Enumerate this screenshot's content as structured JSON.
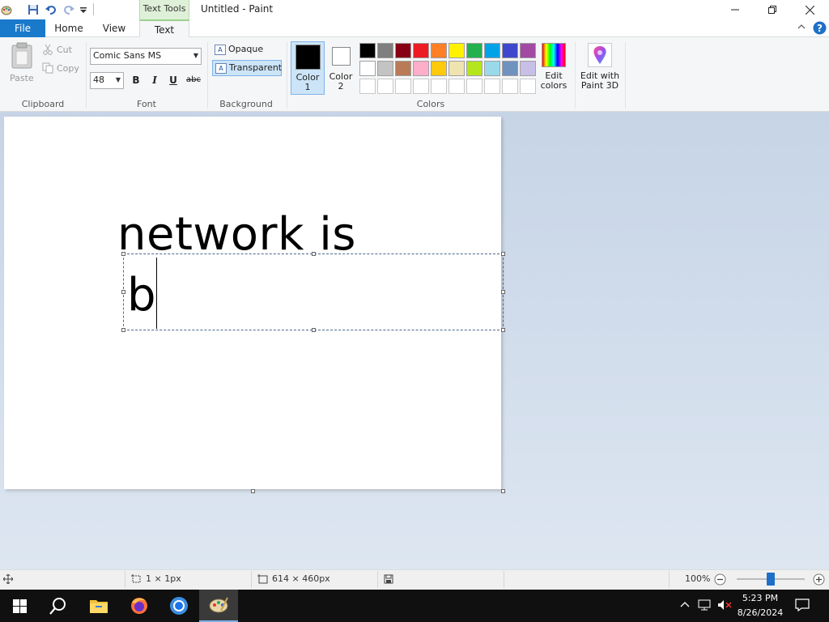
{
  "window": {
    "title": "Untitled - Paint",
    "context_tab_label": "Text Tools"
  },
  "tabs": [
    {
      "label": "File"
    },
    {
      "label": "Home"
    },
    {
      "label": "View"
    },
    {
      "label": "Text"
    }
  ],
  "clipboard": {
    "paste_label": "Paste",
    "cut_label": "Cut",
    "copy_label": "Copy",
    "group_label": "Clipboard"
  },
  "font": {
    "family": "Comic Sans MS",
    "size": "48",
    "bold_label": "B",
    "italic_label": "I",
    "underline_label": "U",
    "strike_label": "abc",
    "group_label": "Font"
  },
  "background": {
    "opaque_label": "Opaque",
    "transparent_label": "Transparent",
    "group_label": "Background",
    "selected": "Transparent"
  },
  "colors": {
    "color1_label": "Color\n1",
    "color2_label": "Color\n2",
    "color1_value": "#000000",
    "color2_value": "#ffffff",
    "edit_colors_label": "Edit\ncolors",
    "paint3d_label": "Edit with\nPaint 3D",
    "group_label": "Colors",
    "palette_row1": [
      "#000000",
      "#7f7f7f",
      "#880015",
      "#ed1c24",
      "#ff7f27",
      "#fff200",
      "#22b14c",
      "#00a2e8",
      "#3f48cc",
      "#a349a4"
    ],
    "palette_row2": [
      "#ffffff",
      "#c3c3c3",
      "#b97a57",
      "#ffaec9",
      "#ffc90e",
      "#efe4b0",
      "#b5e61d",
      "#99d9ea",
      "#7092be",
      "#c8bfe7"
    ]
  },
  "canvas": {
    "text_line1": "network is",
    "text_line2": "b"
  },
  "status": {
    "selection_size": "1 × 1px",
    "image_size": "614 × 460px",
    "zoom": "100%",
    "zoom_fraction": 0.5
  },
  "taskbar": {
    "time": "5:23 PM",
    "date": "8/26/2024"
  }
}
